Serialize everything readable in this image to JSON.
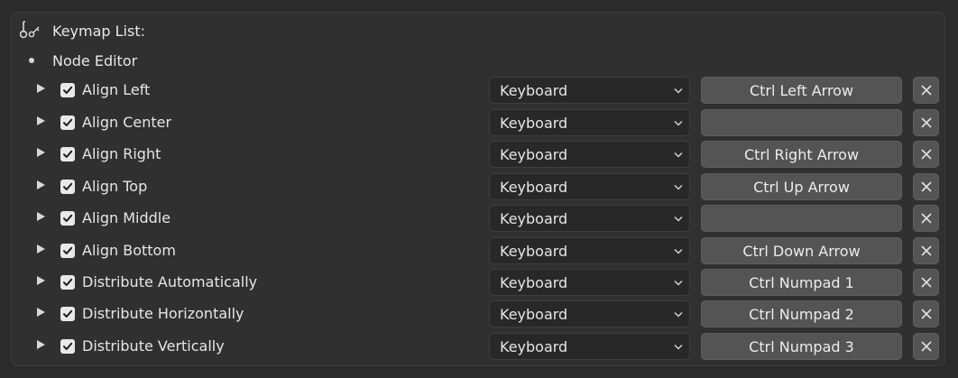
{
  "header": {
    "title": "Keymap List:",
    "icon": "keymap-icon"
  },
  "editor": {
    "label": "Node Editor"
  },
  "items": [
    {
      "label": "Align Left",
      "enabled": true,
      "input_type": "Keyboard",
      "shortcut": "Ctrl Left Arrow"
    },
    {
      "label": "Align Center",
      "enabled": true,
      "input_type": "Keyboard",
      "shortcut": ""
    },
    {
      "label": "Align Right",
      "enabled": true,
      "input_type": "Keyboard",
      "shortcut": "Ctrl Right Arrow"
    },
    {
      "label": "Align Top",
      "enabled": true,
      "input_type": "Keyboard",
      "shortcut": "Ctrl Up Arrow"
    },
    {
      "label": "Align Middle",
      "enabled": true,
      "input_type": "Keyboard",
      "shortcut": ""
    },
    {
      "label": "Align Bottom",
      "enabled": true,
      "input_type": "Keyboard",
      "shortcut": "Ctrl Down Arrow"
    },
    {
      "label": "Distribute Automatically",
      "enabled": true,
      "input_type": "Keyboard",
      "shortcut": "Ctrl Numpad 1"
    },
    {
      "label": "Distribute Horizontally",
      "enabled": true,
      "input_type": "Keyboard",
      "shortcut": "Ctrl Numpad 2"
    },
    {
      "label": "Distribute Vertically",
      "enabled": true,
      "input_type": "Keyboard",
      "shortcut": "Ctrl Numpad 3"
    }
  ]
}
